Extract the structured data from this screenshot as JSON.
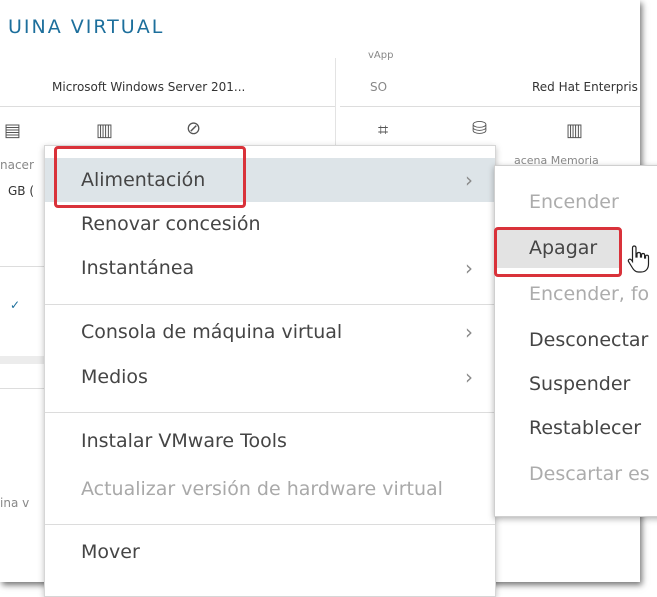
{
  "panel": {
    "title": "UINA VIRTUAL"
  },
  "background": {
    "left_os": "Microsoft Windows Server 201...",
    "right_label_top": "vApp",
    "right_so_label": "SO",
    "right_os": "Red Hat Enterpris",
    "left_partial_1": "nacer",
    "left_partial_2": "GB (",
    "right_partial": "acena  Memoria",
    "left_partial_bottom": "ina v"
  },
  "menu": {
    "items": [
      {
        "label": "Alimentación",
        "has_submenu": true,
        "active": true,
        "disabled": false
      },
      {
        "label": "Renovar concesión",
        "has_submenu": false,
        "active": false,
        "disabled": false
      },
      {
        "label": "Instantánea",
        "has_submenu": true,
        "active": false,
        "disabled": false
      },
      {
        "label": "Consola de máquina virtual",
        "has_submenu": true,
        "active": false,
        "disabled": false
      },
      {
        "label": "Medios",
        "has_submenu": true,
        "active": false,
        "disabled": false
      },
      {
        "label": "Instalar VMware Tools",
        "has_submenu": false,
        "active": false,
        "disabled": false
      },
      {
        "label": "Actualizar versión de hardware virtual",
        "has_submenu": false,
        "active": false,
        "disabled": true
      },
      {
        "label": "Mover",
        "has_submenu": false,
        "active": false,
        "disabled": false
      }
    ],
    "chevron": "›"
  },
  "submenu": {
    "items": [
      {
        "label": "Encender",
        "disabled": true
      },
      {
        "label": "Apagar",
        "disabled": false,
        "hover": true
      },
      {
        "label": "Encender, fo",
        "disabled": true
      },
      {
        "label": "Desconectar",
        "disabled": false
      },
      {
        "label": "Suspender",
        "disabled": false
      },
      {
        "label": "Restablecer",
        "disabled": false
      },
      {
        "label": "Descartar es",
        "disabled": true
      }
    ]
  },
  "colors": {
    "accent": "#1d6f9c",
    "highlight": "#d9323a",
    "active_bg": "#dde4e8"
  }
}
